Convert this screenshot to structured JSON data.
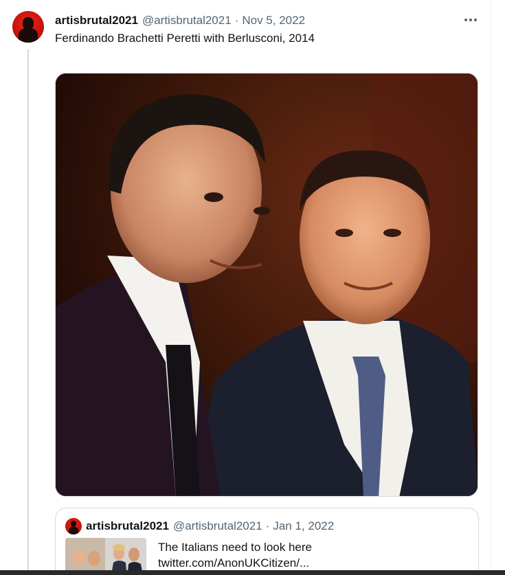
{
  "tweet": {
    "display_name": "artisbrutal2021",
    "handle": "@artisbrutal2021",
    "separator": "·",
    "date": "Nov 5, 2022",
    "text": "Ferdinando Brachetti Peretti with Berlusconi, 2014",
    "more_icon": "more-horizontal-icon",
    "avatar_colors": {
      "background": "#d8160e",
      "figure": "#1a0a08"
    }
  },
  "quote": {
    "display_name": "artisbrutal2021",
    "handle": "@artisbrutal2021",
    "separator": "·",
    "date": "Jan 1, 2022",
    "text_line1": "The Italians need to look here",
    "text_line2": "twitter.com/AnonUKCitizen/..."
  },
  "colors": {
    "text_primary": "#0f1419",
    "text_secondary": "#536471",
    "border": "#cfd9de"
  }
}
